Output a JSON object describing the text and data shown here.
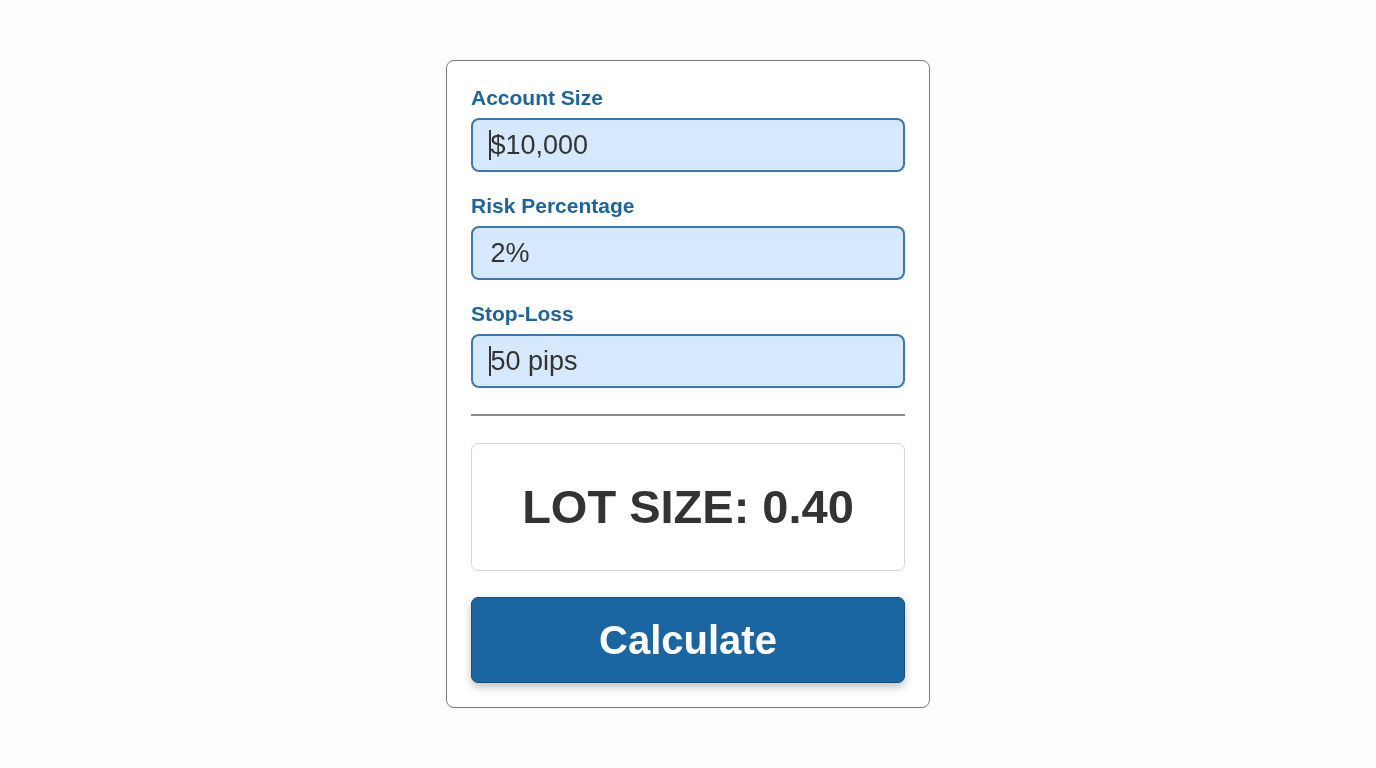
{
  "fields": [
    {
      "label": "Account Size",
      "value": "$10,000",
      "caret": true
    },
    {
      "label": "Risk Percentage",
      "value": "2%",
      "caret": false
    },
    {
      "label": "Stop-Loss",
      "value": "50 pips",
      "caret": true
    }
  ],
  "result": {
    "text": "LOT SIZE: 0.40"
  },
  "button": {
    "label": "Calculate"
  }
}
